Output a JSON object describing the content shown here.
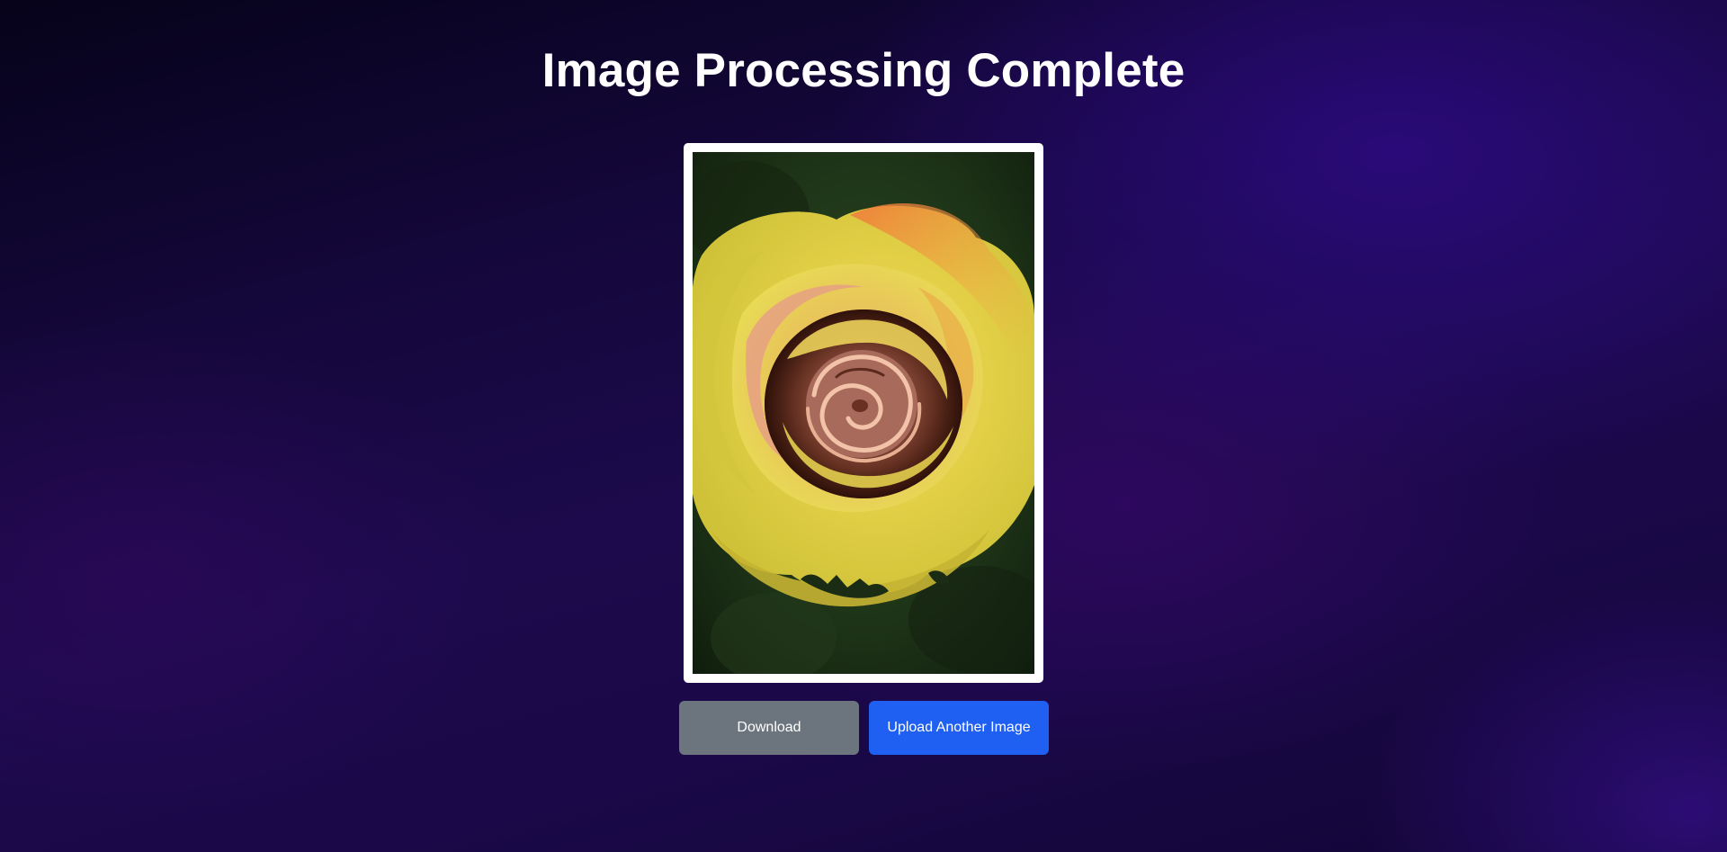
{
  "page": {
    "title": "Image Processing Complete"
  },
  "result_image": {
    "alt": "Processed image of a yellow and orange rose",
    "subject": "rose"
  },
  "actions": {
    "download_label": "Download",
    "upload_label": "Upload Another Image"
  },
  "colors": {
    "download_button": "#6c757d",
    "upload_button": "#1f5ff2",
    "frame": "#ffffff",
    "title_text": "#ffffff"
  }
}
